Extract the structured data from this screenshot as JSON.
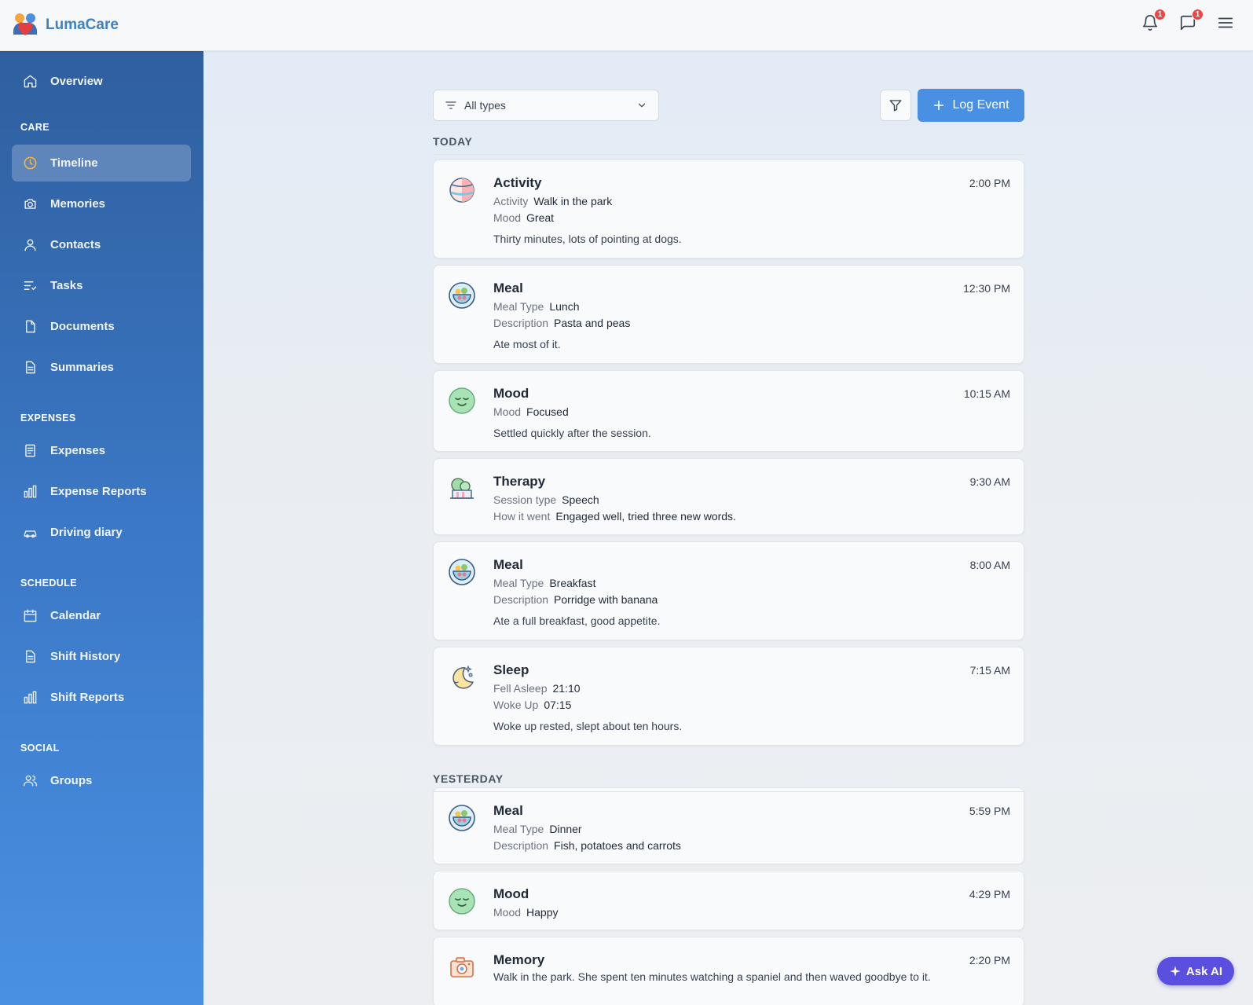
{
  "app": {
    "name": "LumaCare"
  },
  "header": {
    "notifications_count": "1",
    "messages_count": "1"
  },
  "sidebar": {
    "overview": "Overview",
    "sections": {
      "care": "CARE",
      "expenses": "EXPENSES",
      "schedule": "SCHEDULE",
      "social": "SOCIAL"
    },
    "items": {
      "timeline": "Timeline",
      "memories": "Memories",
      "contacts": "Contacts",
      "tasks": "Tasks",
      "documents": "Documents",
      "summaries": "Summaries",
      "expenses": "Expenses",
      "expense_reports": "Expense Reports",
      "driving_diary": "Driving diary",
      "calendar": "Calendar",
      "shift_history": "Shift History",
      "shift_reports": "Shift Reports",
      "groups": "Groups"
    },
    "active": "timeline"
  },
  "toolbar": {
    "type_select": "All types",
    "log_event": "Log Event"
  },
  "timeline": {
    "today_label": "TODAY",
    "yesterday_label": "YESTERDAY",
    "events": [
      {
        "title": "Activity",
        "time": "2:00 PM",
        "icon": "ball-icon",
        "fields": [
          {
            "k": "Activity",
            "v": "Walk in the park"
          },
          {
            "k": "Mood",
            "v": "Great"
          }
        ],
        "note": "Thirty minutes, lots of pointing at dogs."
      },
      {
        "title": "Meal",
        "time": "12:30 PM",
        "icon": "food-bowl-icon",
        "fields": [
          {
            "k": "Meal Type",
            "v": "Lunch"
          },
          {
            "k": "Description",
            "v": "Pasta and peas"
          }
        ],
        "note": "Ate most of it."
      },
      {
        "title": "Mood",
        "time": "10:15 AM",
        "icon": "smiley-icon",
        "fields": [
          {
            "k": "Mood",
            "v": "Focused"
          }
        ],
        "note": "Settled quickly after the session."
      },
      {
        "title": "Therapy",
        "time": "9:30 AM",
        "icon": "therapy-icon",
        "fields": [
          {
            "k": "Session type",
            "v": "Speech"
          },
          {
            "k": "How it went",
            "v": "Engaged well, tried three new words."
          }
        ],
        "note": ""
      },
      {
        "title": "Meal",
        "time": "8:00 AM",
        "icon": "food-bowl-icon",
        "fields": [
          {
            "k": "Meal Type",
            "v": "Breakfast"
          },
          {
            "k": "Description",
            "v": "Porridge with banana"
          }
        ],
        "note": "Ate a full breakfast, good appetite."
      },
      {
        "title": "Sleep",
        "time": "7:15 AM",
        "icon": "moon-icon",
        "fields": [
          {
            "k": "Fell Asleep",
            "v": "21:10"
          },
          {
            "k": "Woke Up",
            "v": "07:15"
          }
        ],
        "note": "Woke up rested, slept about ten hours."
      },
      {
        "title": "Meal",
        "time": "5:59 PM",
        "icon": "food-bowl-icon",
        "fields": [
          {
            "k": "Meal Type",
            "v": "Dinner"
          },
          {
            "k": "Description",
            "v": "Fish, potatoes and carrots"
          }
        ],
        "note": ""
      },
      {
        "title": "Mood",
        "time": "4:29 PM",
        "icon": "smiley-icon",
        "fields": [
          {
            "k": "Mood",
            "v": "Happy"
          }
        ],
        "note": ""
      },
      {
        "title": "Memory",
        "time": "2:20 PM",
        "icon": "camera-icon",
        "fields": [],
        "note": "Walk in the park. She spent ten minutes watching a spaniel and then waved goodbye to it."
      }
    ]
  },
  "ask_ai": "Ask AI",
  "colors": {
    "accent": "#4a90e2",
    "brand": "#3b82c6",
    "badge": "#ef4444",
    "ai": "#5b4fe0"
  }
}
